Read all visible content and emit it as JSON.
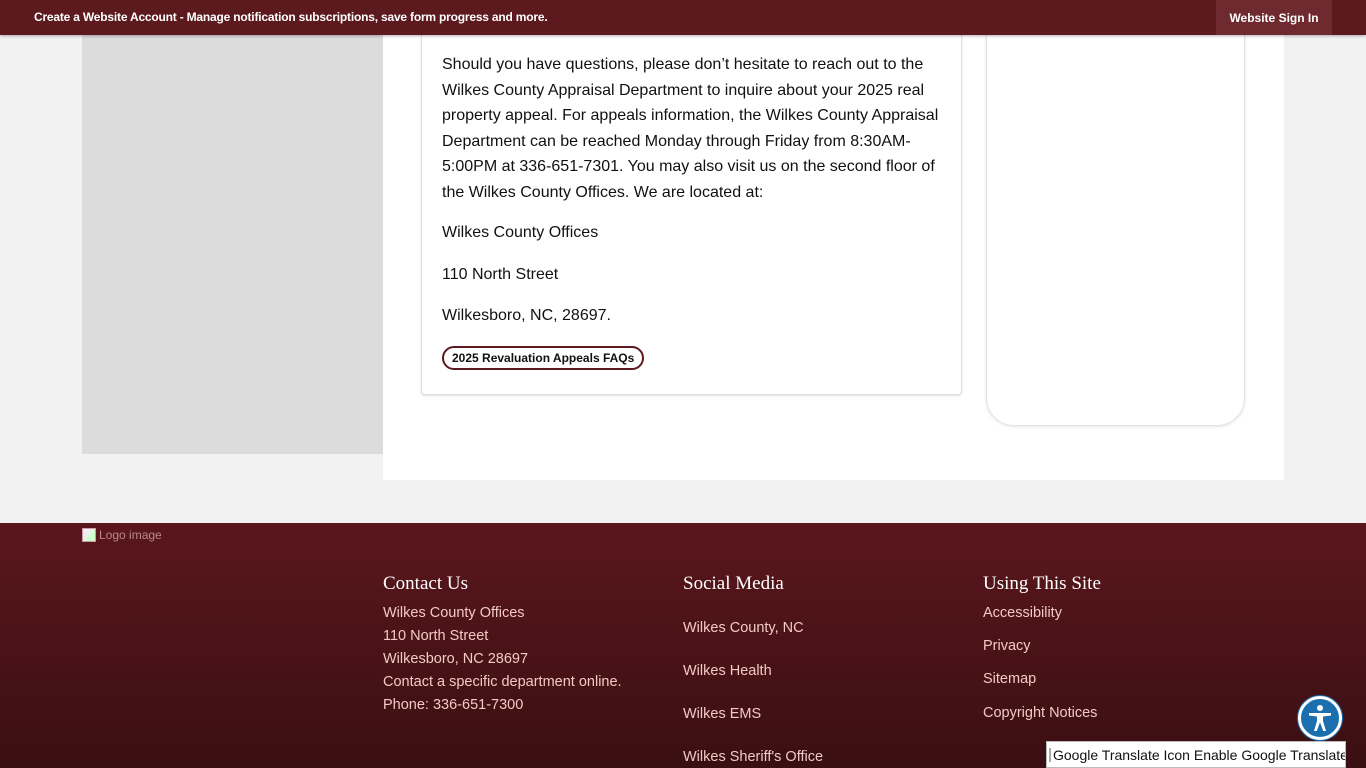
{
  "topbar": {
    "promo_text": "Create a Website Account - Manage notification subscriptions, save form progress and more.",
    "signin_label": "Website Sign In"
  },
  "main": {
    "paragraph": "Should you have questions, please don’t hesitate to reach out to the Wilkes County Appraisal Department to inquire about your 2025 real property appeal. For appeals information, the Wilkes County Appraisal Department can be reached Monday through Friday from 8:30AM-5:00PM at 336-651-7301. You may also visit us on the second floor of the Wilkes County Offices. We are located at:",
    "address_lines": [
      "Wilkes County Offices",
      "110 North Street",
      "Wilkesboro, NC, 28697."
    ],
    "faq_button": "2025 Revaluation Appeals FAQs"
  },
  "footer": {
    "logo_alt": "Logo image",
    "contact": {
      "heading": "Contact Us",
      "lines": [
        "Wilkes County Offices",
        "110 North Street",
        "Wilkesboro, NC 28697"
      ],
      "contact_link": "Contact a specific department online.",
      "phone": "Phone: 336-651-7300"
    },
    "social": {
      "heading": "Social Media",
      "links": [
        "Wilkes County, NC",
        "Wilkes Health",
        "Wilkes EMS",
        "Wilkes Sheriff's Office"
      ]
    },
    "using_site": {
      "heading": "Using This Site",
      "links": [
        "Accessibility",
        "Privacy",
        "Sitemap",
        "Copyright Notices"
      ]
    }
  },
  "widgets": {
    "accessibility_icon": "accessibility-icon",
    "translate_label": "Google Translate Icon Enable Google Translate"
  },
  "colors": {
    "brand_maroon": "#5c1a1e",
    "footer_link": "#f3c9c4",
    "accessibility_blue": "#1c6fae"
  }
}
